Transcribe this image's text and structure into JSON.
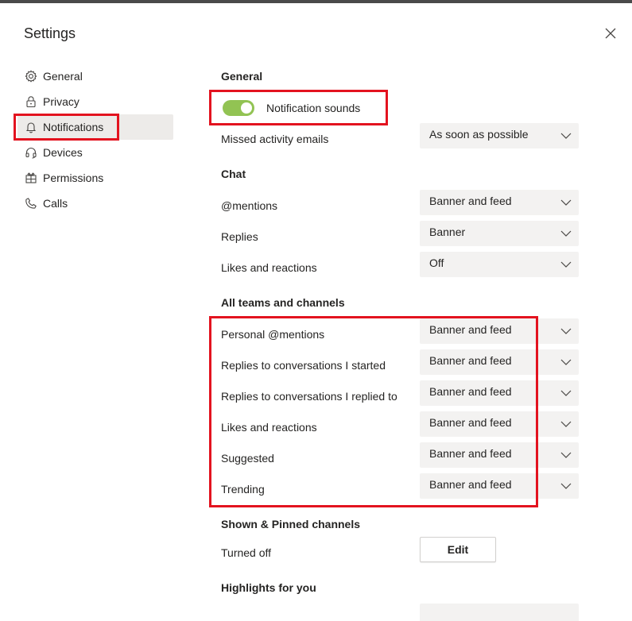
{
  "title": "Settings",
  "sidebar": {
    "items": [
      {
        "label": "General",
        "icon": "gear-icon"
      },
      {
        "label": "Privacy",
        "icon": "lock-icon"
      },
      {
        "label": "Notifications",
        "icon": "bell-icon"
      },
      {
        "label": "Devices",
        "icon": "headset-icon"
      },
      {
        "label": "Permissions",
        "icon": "permissions-icon"
      },
      {
        "label": "Calls",
        "icon": "phone-icon"
      }
    ],
    "active": "Notifications"
  },
  "general": {
    "heading": "General",
    "notification_sounds": {
      "label": "Notification sounds",
      "on": true
    },
    "missed_activity": {
      "label": "Missed activity emails",
      "value": "As soon as possible"
    }
  },
  "chat": {
    "heading": "Chat",
    "rows": [
      {
        "label": "@mentions",
        "value": "Banner and feed"
      },
      {
        "label": "Replies",
        "value": "Banner"
      },
      {
        "label": "Likes and reactions",
        "value": "Off"
      }
    ]
  },
  "teams": {
    "heading": "All teams and channels",
    "rows": [
      {
        "label": "Personal @mentions",
        "value": "Banner and feed"
      },
      {
        "label": "Replies to conversations I started",
        "value": "Banner and feed"
      },
      {
        "label": "Replies to conversations I replied to",
        "value": "Banner and feed"
      },
      {
        "label": "Likes and reactions",
        "value": "Banner and feed"
      },
      {
        "label": "Suggested",
        "value": "Banner and feed"
      },
      {
        "label": "Trending",
        "value": "Banner and feed"
      }
    ]
  },
  "shown_pinned": {
    "heading": "Shown & Pinned channels",
    "label": "Turned off",
    "button": "Edit"
  },
  "highlights": {
    "heading": "Highlights for you"
  },
  "colors": {
    "accent_toggle": "#92c353",
    "highlight": "#e3131f",
    "active_nav": "#edebe9"
  }
}
